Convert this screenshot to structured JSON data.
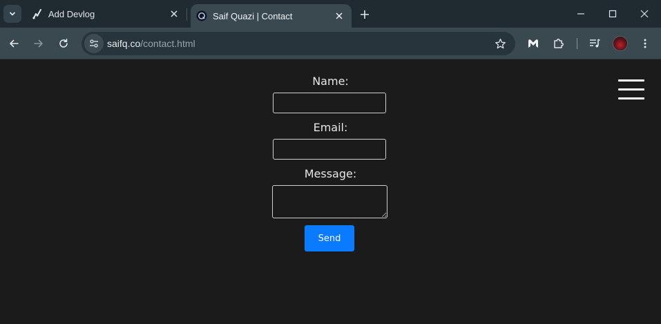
{
  "browser": {
    "tabs": [
      {
        "title": "Add Devlog",
        "favicon": "devlog-icon",
        "active": false
      },
      {
        "title": "Saif Quazi | Contact",
        "favicon": "sq-logo-icon",
        "active": true
      }
    ],
    "url": {
      "host": "saifq.co",
      "path": "/contact.html"
    }
  },
  "contact_form": {
    "name_label": "Name:",
    "name_value": "",
    "email_label": "Email:",
    "email_value": "",
    "message_label": "Message:",
    "message_value": "",
    "send_label": "Send"
  },
  "colors": {
    "page_bg": "#1b1b1b",
    "chrome_bg": "#202a31",
    "toolbar_bg": "#3a4850",
    "accent": "#0a7bff"
  }
}
